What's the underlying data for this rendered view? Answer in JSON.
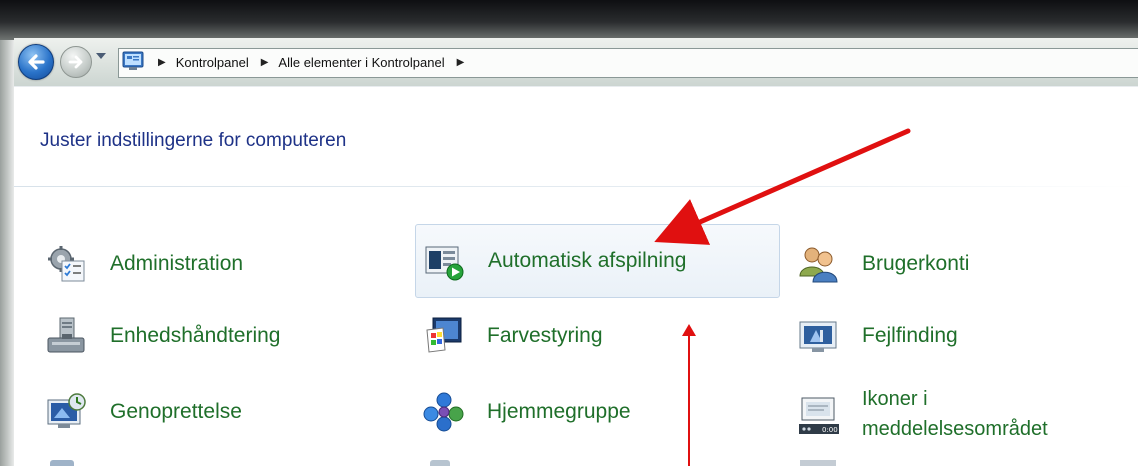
{
  "breadcrumb": {
    "items": [
      {
        "label": "Kontrolpanel"
      },
      {
        "label": "Alle elementer i Kontrolpanel"
      }
    ]
  },
  "page": {
    "title": "Juster indstillingerne for computeren"
  },
  "items": {
    "administration": "Administration",
    "automatisk": "Automatisk afspilning",
    "brugerkonti": "Brugerkonti",
    "enhed": "Enhedshåndtering",
    "farve": "Farvestyring",
    "fejl": "Fejlfinding",
    "genoprettelse": "Genoprettelse",
    "hjemmegruppe": "Hjemmegruppe",
    "ikoner_line1": "Ikoner i",
    "ikoner_line2": "meddelelsesområdet",
    "ikoner_clock": "0:00"
  },
  "colors": {
    "link_green": "#1f6f2a",
    "title_blue": "#1e3287",
    "annotation_red": "#e01010"
  },
  "icons": {
    "back": "back-arrow-icon",
    "forward": "forward-arrow-icon",
    "control_panel": "control-panel-icon"
  }
}
